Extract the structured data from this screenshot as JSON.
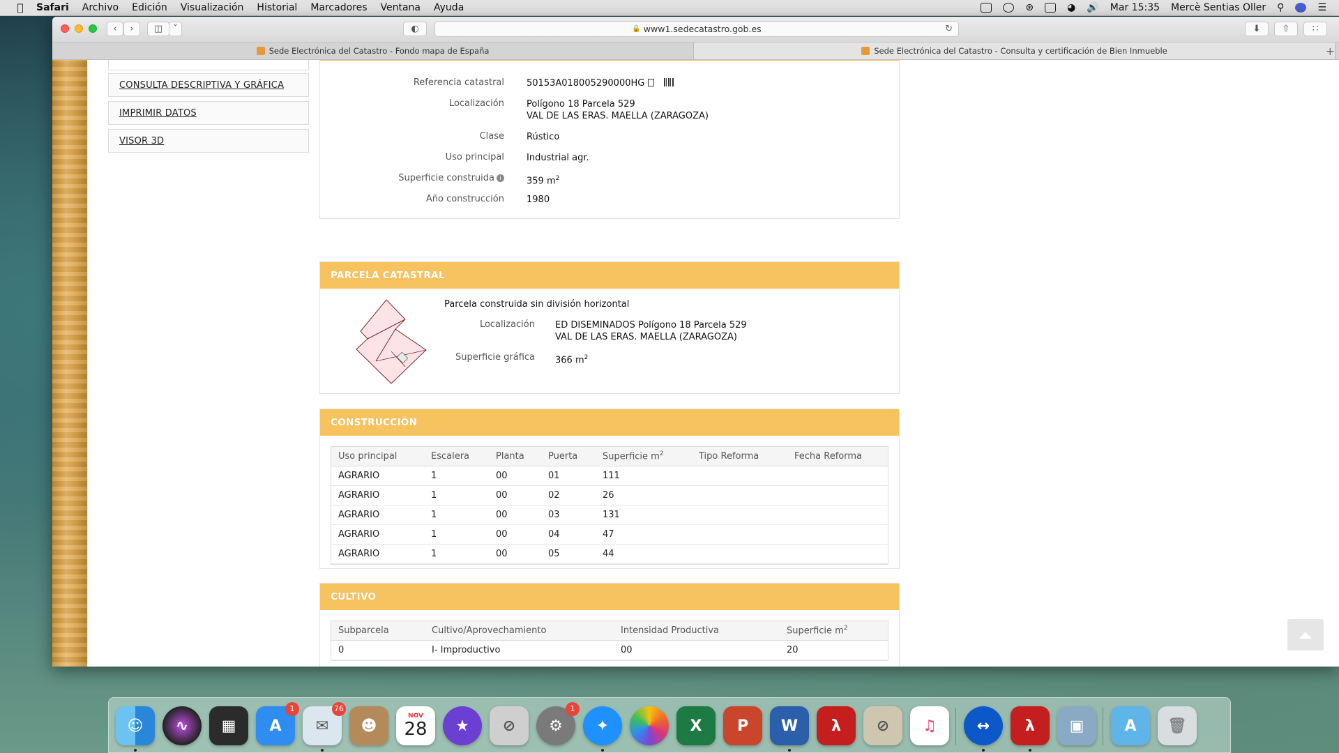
{
  "menubar": {
    "app": "Safari",
    "items": [
      "Archivo",
      "Edición",
      "Visualización",
      "Historial",
      "Marcadores",
      "Ventana",
      "Ayuda"
    ],
    "clock": "Mar 15:35",
    "user": "Mercè Sentias Oller"
  },
  "browser": {
    "url": "www1.sedecatastro.gob.es",
    "tabs": [
      {
        "title": "Sede Electrónica del Catastro - Fondo mapa de España"
      },
      {
        "title": "Sede Electrónica del Catastro - Consulta y certificación de Bien Inmueble"
      }
    ]
  },
  "sidebar": {
    "items": [
      {
        "label": "CONSULTA DESCRIPTIVA Y GRÁFICA"
      },
      {
        "label": "IMPRIMIR DATOS"
      },
      {
        "label": "VISOR 3D"
      }
    ]
  },
  "inmueble": {
    "ref_label": "Referencia catastral",
    "ref_value": "50153A018005290000HG",
    "loc_label": "Localización",
    "loc_line1": "Polígono 18 Parcela 529",
    "loc_line2": "VAL DE LAS ERAS. MAELLA (ZARAGOZA)",
    "clase_label": "Clase",
    "clase_value": "Rústico",
    "uso_label": "Uso principal",
    "uso_value": "Industrial agr.",
    "sup_label": "Superficie construida",
    "sup_value": "359 m",
    "sup_unit_exp": "2",
    "ano_label": "Año construcción",
    "ano_value": "1980"
  },
  "parcela": {
    "title": "PARCELA CATASTRAL",
    "subtitle": "Parcela construida sin división horizontal",
    "loc_label": "Localización",
    "loc_line1": "ED DISEMINADOS Polígono 18 Parcela 529",
    "loc_line2": "VAL DE LAS ERAS. MAELLA (ZARAGOZA)",
    "sup_label": "Superficie gráfica",
    "sup_value": "366 m",
    "sup_unit_exp": "2"
  },
  "construccion": {
    "title": "CONSTRUCCIÓN",
    "headers": [
      "Uso principal",
      "Escalera",
      "Planta",
      "Puerta",
      "Superficie m",
      "Tipo Reforma",
      "Fecha Reforma"
    ],
    "sup_exp": "2",
    "rows": [
      [
        "AGRARIO",
        "1",
        "00",
        "01",
        "111",
        "",
        ""
      ],
      [
        "AGRARIO",
        "1",
        "00",
        "02",
        "26",
        "",
        ""
      ],
      [
        "AGRARIO",
        "1",
        "00",
        "03",
        "131",
        "",
        ""
      ],
      [
        "AGRARIO",
        "1",
        "00",
        "04",
        "47",
        "",
        ""
      ],
      [
        "AGRARIO",
        "1",
        "00",
        "05",
        "44",
        "",
        ""
      ]
    ]
  },
  "cultivo": {
    "title": "CULTIVO",
    "headers": [
      "Subparcela",
      "Cultivo/Aprovechamiento",
      "Intensidad Productiva",
      "Superficie m"
    ],
    "sup_exp": "2",
    "rows": [
      [
        "0",
        "I- Improductivo",
        "00",
        "20"
      ]
    ]
  },
  "dock": {
    "badges": {
      "appstore": "1",
      "mail": "76",
      "prefs": "1"
    },
    "calendar": {
      "month": "NOV",
      "day": "28"
    },
    "icons": [
      "finder-icon",
      "siri-icon",
      "mission-control-icon",
      "app-store-icon",
      "mail-icon",
      "contacts-icon",
      "calendar-icon",
      "imovie-icon",
      "blocked-app-icon",
      "system-preferences-icon",
      "safari-icon",
      "photos-icon",
      "excel-icon",
      "powerpoint-icon",
      "word-icon",
      "acrobat-icon",
      "blocked-app-icon",
      "music-icon",
      "teamviewer-icon",
      "acrobat-reader-icon",
      "preview-icon",
      "applications-folder-icon",
      "trash-icon"
    ]
  },
  "colors": {
    "panel_head": "#f7c35e",
    "panel_head_text": "#ffffff"
  }
}
